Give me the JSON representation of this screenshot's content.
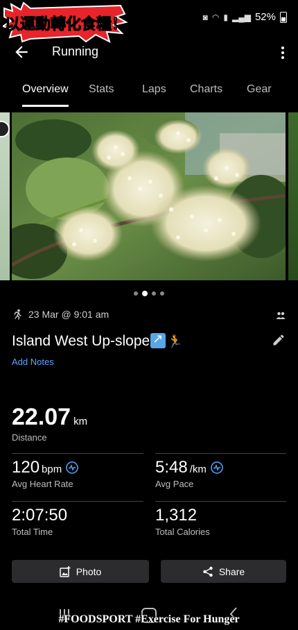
{
  "status_bar": {
    "logo_text": "以運動轉化食糧！",
    "battery": "52%"
  },
  "app_bar": {
    "title": "Running"
  },
  "tabs": [
    {
      "label": "Overview",
      "active": true
    },
    {
      "label": "Stats",
      "active": false
    },
    {
      "label": "Laps",
      "active": false
    },
    {
      "label": "Charts",
      "active": false
    },
    {
      "label": "Gear",
      "active": false
    }
  ],
  "carousel": {
    "page_count": 4,
    "active_index": 1
  },
  "activity": {
    "datetime": "23 Mar @ 9:01 am",
    "title": "Island West Up-slope",
    "add_notes": "Add Notes"
  },
  "stats": {
    "distance": {
      "value": "22.07",
      "unit": "km",
      "label": "Distance"
    },
    "heart_rate": {
      "value": "120",
      "unit": "bpm",
      "label": "Avg Heart Rate"
    },
    "pace": {
      "value": "5:48",
      "unit": "/km",
      "label": "Avg Pace"
    },
    "time": {
      "value": "2:07:50",
      "label": "Total Time"
    },
    "calories": {
      "value": "1,312",
      "label": "Total Calories"
    }
  },
  "buttons": {
    "photo": "Photo",
    "share": "Share"
  },
  "watermark": "#FOODSPORT #Exercise For Hunger",
  "colors": {
    "background": "#000000",
    "accent_link": "#5aa8ff",
    "button_bg": "#2c2c2e",
    "logo_red": "#e8232a",
    "logo_yellow": "#ffe600"
  }
}
